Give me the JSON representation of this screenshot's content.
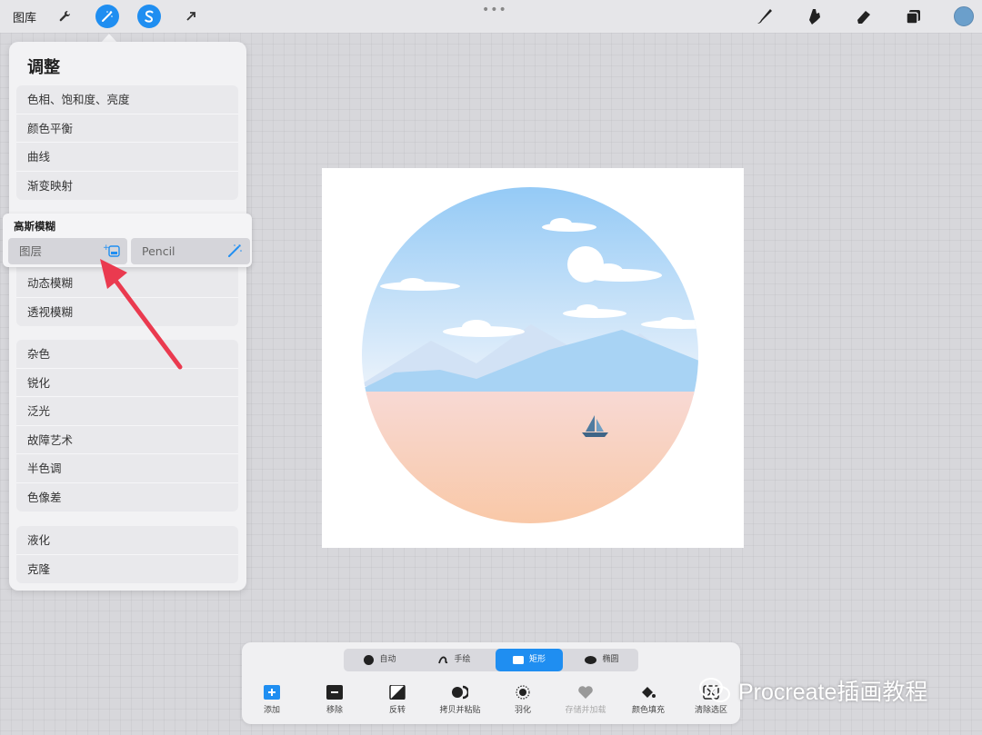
{
  "topbar": {
    "gallery_label": "图库",
    "tools_left": [
      {
        "name": "actions",
        "icon": "wrench-icon"
      },
      {
        "name": "adjustments",
        "icon": "magic-wand-icon",
        "active": true
      },
      {
        "name": "selection",
        "icon": "selection-s-icon",
        "active": true
      },
      {
        "name": "transform",
        "icon": "arrow-icon"
      }
    ],
    "handle": "•••",
    "tools_right": [
      {
        "name": "brush",
        "icon": "brush-icon"
      },
      {
        "name": "smudge",
        "icon": "smudge-icon"
      },
      {
        "name": "eraser",
        "icon": "eraser-icon"
      },
      {
        "name": "layers",
        "icon": "layers-icon"
      }
    ],
    "color": "#6b9fcb"
  },
  "adjust_panel": {
    "title": "调整",
    "group1": [
      "色相、饱和度、亮度",
      "颜色平衡",
      "曲线",
      "渐变映射"
    ],
    "group2": [
      "动态模糊",
      "透视模糊"
    ],
    "group3": [
      "杂色",
      "锐化",
      "泛光",
      "故障艺术",
      "半色调",
      "色像差"
    ],
    "group4": [
      "液化",
      "克隆"
    ]
  },
  "blur_popup": {
    "title": "高斯模糊",
    "option_layer": "图层",
    "option_pencil": "Pencil"
  },
  "selection_bar": {
    "modes": [
      {
        "label": "自动",
        "active": false
      },
      {
        "label": "手绘",
        "active": false
      },
      {
        "label": "矩形",
        "active": true
      },
      {
        "label": "椭圆",
        "active": false
      }
    ],
    "actions": [
      {
        "label": "添加",
        "icon": "add-icon"
      },
      {
        "label": "移除",
        "icon": "remove-icon"
      },
      {
        "label": "反转",
        "icon": "invert-icon"
      },
      {
        "label": "拷贝并粘贴",
        "icon": "copy-paste-icon"
      },
      {
        "label": "羽化",
        "icon": "feather-icon"
      },
      {
        "label": "存储并加载",
        "icon": "heart-icon",
        "disabled": true
      },
      {
        "label": "颜色填充",
        "icon": "fill-icon"
      },
      {
        "label": "清除选区",
        "icon": "clear-icon"
      }
    ]
  },
  "watermark": "Procreate插画教程",
  "colors": {
    "accent": "#1f8ef1",
    "arrow": "#ea3a4f"
  }
}
